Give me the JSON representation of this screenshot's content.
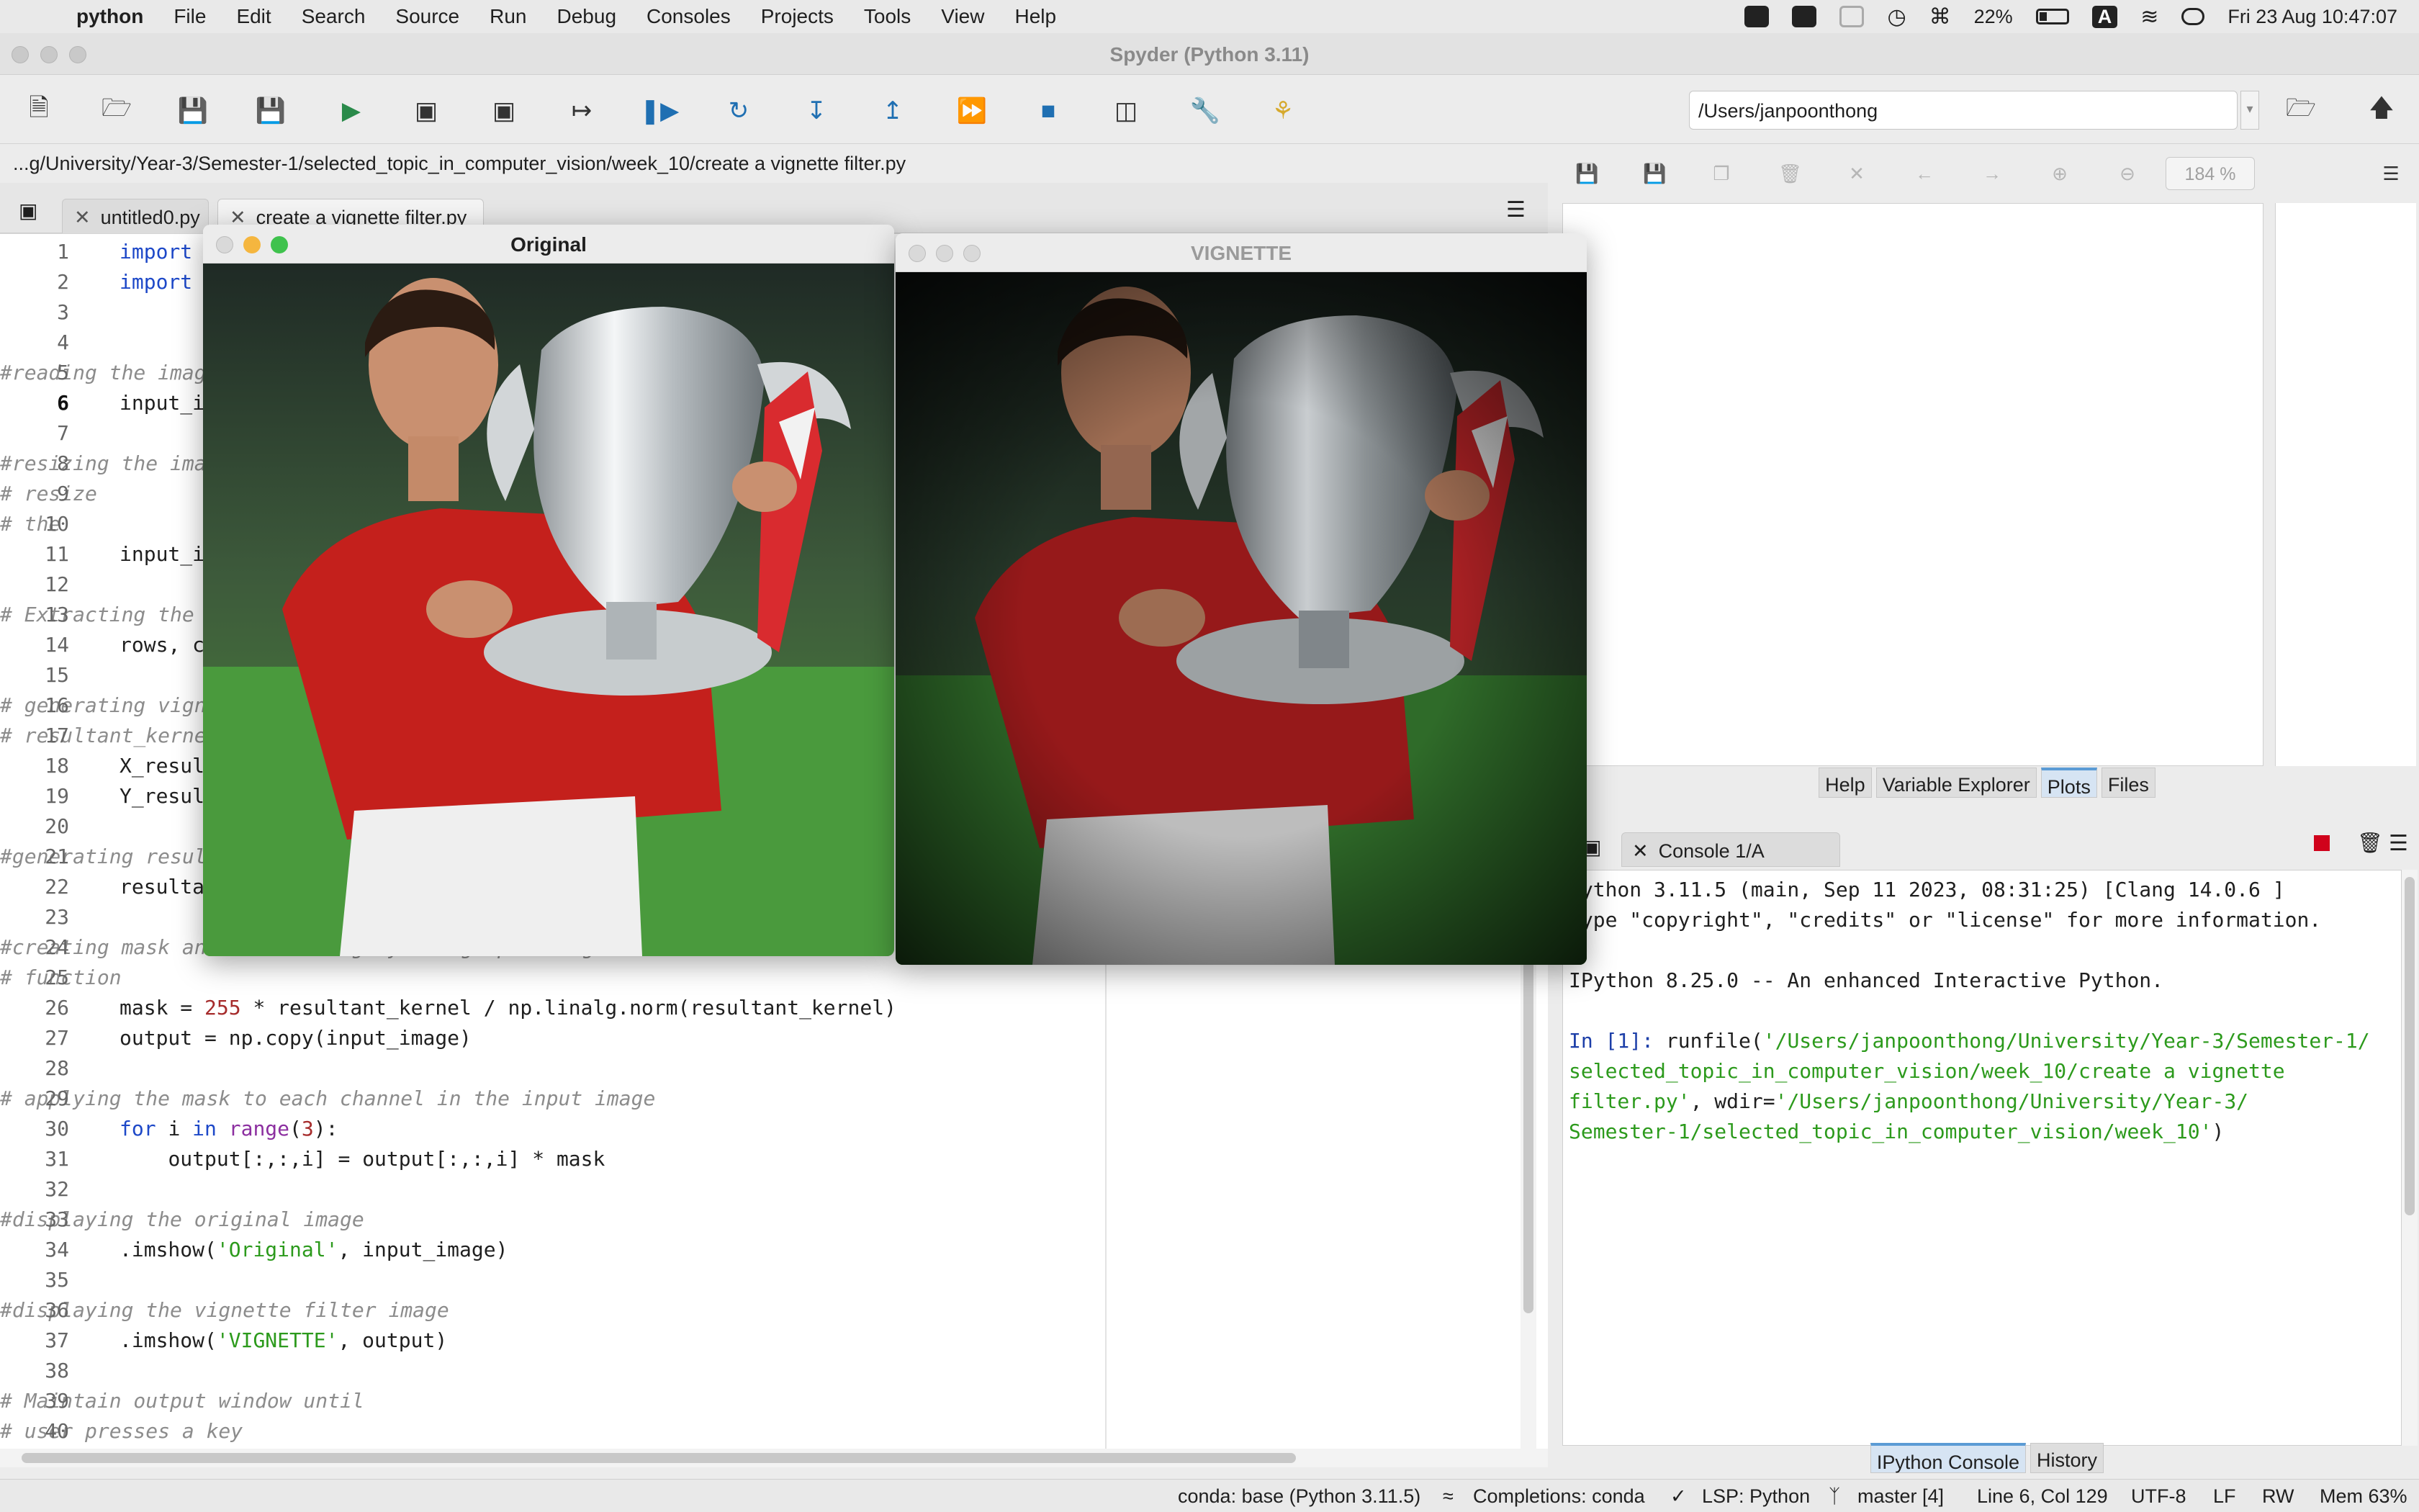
{
  "menubar": {
    "app": "python",
    "items": [
      "File",
      "Edit",
      "Search",
      "Source",
      "Run",
      "Debug",
      "Consoles",
      "Projects",
      "Tools",
      "View",
      "Help"
    ],
    "battery": "22%",
    "input_source": "A",
    "datetime": "Fri 23 Aug  10:47:07"
  },
  "window": {
    "title": "Spyder (Python 3.11)"
  },
  "toolbar": {
    "buttons": [
      "new-file",
      "open-file",
      "save-file",
      "save-all",
      "run",
      "run-cell",
      "run-cell-advance",
      "run-selection",
      "debug",
      "step",
      "step-into",
      "step-return",
      "continue",
      "stop",
      "maximize-pane",
      "preferences",
      "python-path-manager"
    ],
    "working_dir": "/Users/janpoonthong"
  },
  "editor": {
    "file_path": "...g/University/Year-3/Semester-1/selected_topic_in_computer_vision/week_10/create a vignette filter.py",
    "tabs": [
      {
        "label": "untitled0.py"
      },
      {
        "label": "create a vignette filter.py"
      }
    ],
    "current_line": 6,
    "lines": [
      {
        "n": "1",
        "text": "import cv2"
      },
      {
        "n": "2",
        "text": "import numpy as np"
      },
      {
        "n": "3",
        "text": ""
      },
      {
        "n": "4",
        "text": ""
      },
      {
        "n": "5",
        "text": "#reading the image"
      },
      {
        "n": "6",
        "text": "input_image = cv2.imread('cr7.jpg')"
      },
      {
        "n": "7",
        "text": ""
      },
      {
        "n": "8",
        "text": "#resizing the image"
      },
      {
        "n": "9",
        "text": "# resize"
      },
      {
        "n": "10",
        "text": "# the"
      },
      {
        "n": "11",
        "text": "input_image = cv2.resize(input_image, (480, 480))"
      },
      {
        "n": "12",
        "text": ""
      },
      {
        "n": "13",
        "text": "# Extracting the height and width of an image"
      },
      {
        "n": "14",
        "text": "rows, cols = input_image.shape[:2]"
      },
      {
        "n": "15",
        "text": ""
      },
      {
        "n": "16",
        "text": "# generating vignette mask using Gaussian"
      },
      {
        "n": "17",
        "text": "# resultant_kernels"
      },
      {
        "n": "18",
        "text": "X_resultant_kernel = cv2.getGaussianKernel(cols,200)"
      },
      {
        "n": "19",
        "text": "Y_resultant_kernel = cv2.getGaussianKernel(rows,200)"
      },
      {
        "n": "20",
        "text": ""
      },
      {
        "n": "21",
        "text": "#generating resultant_kernel matrix"
      },
      {
        "n": "22",
        "text": "resultant_kernel = Y_resultant_kernel * X_resultant_kernel.T"
      },
      {
        "n": "23",
        "text": ""
      },
      {
        "n": "24",
        "text": "#creating mask and normalising by using np.linalg"
      },
      {
        "n": "25",
        "text": "# function"
      },
      {
        "n": "26",
        "text": "mask = 255 * resultant_kernel / np.linalg.norm(resultant_kernel)"
      },
      {
        "n": "27",
        "text": "output = np.copy(input_image)"
      },
      {
        "n": "28",
        "text": ""
      },
      {
        "n": "29",
        "text": "# applying the mask to each channel in the input image"
      },
      {
        "n": "30",
        "text": "for i in range(3):"
      },
      {
        "n": "31",
        "text": "    output[:,:,i] = output[:,:,i] * mask"
      },
      {
        "n": "32",
        "text": ""
      },
      {
        "n": "33",
        "text": "#displaying the original image"
      },
      {
        "n": "34",
        "text": "cv2.imshow('Original', input_image)"
      },
      {
        "n": "35",
        "text": ""
      },
      {
        "n": "36",
        "text": "#displaying the vignette filter image"
      },
      {
        "n": "37",
        "text": "cv2.imshow('VIGNETTE', output)"
      },
      {
        "n": "38",
        "text": ""
      },
      {
        "n": "39",
        "text": "# Maintain output window until"
      },
      {
        "n": "40",
        "text": "# user presses a key"
      }
    ]
  },
  "plots": {
    "zoom": "184 %",
    "tabs": [
      "Help",
      "Variable Explorer",
      "Plots",
      "Files"
    ],
    "active_tab": "Plots"
  },
  "console": {
    "tab_label": "Console 1/A",
    "lines": [
      "Python 3.11.5 (main, Sep 11 2023, 08:31:25) [Clang 14.0.6 ]",
      "Type \"copyright\", \"credits\" or \"license\" for more information.",
      "",
      "IPython 8.25.0 -- An enhanced Interactive Python.",
      ""
    ],
    "prompt": "In [1]:",
    "command_prefix": " runfile(",
    "command_path1": "'/Users/janpoonthong/University/Year-3/Semester-1/",
    "command_path2": "selected_topic_in_computer_vision/week_10/create a vignette",
    "command_path3": "filter.py'",
    "command_mid": ", wdir=",
    "command_path4": "'/Users/janpoonthong/University/Year-3/",
    "command_path5": "Semester-1/selected_topic_in_computer_vision/week_10'",
    "command_suffix": ")",
    "bottom_tabs": [
      "IPython Console",
      "History"
    ],
    "active_bottom_tab": "IPython Console"
  },
  "statusbar": {
    "env": "conda: base (Python 3.11.5)",
    "completions": "Completions: conda",
    "lsp": "LSP: Python",
    "git": "master [4]",
    "cursor": "Line 6, Col 129",
    "encoding": "UTF-8",
    "eol": "LF",
    "rw": "RW",
    "mem": "Mem 63%"
  },
  "image_windows": [
    {
      "title": "Original"
    },
    {
      "title": "VIGNETTE"
    }
  ]
}
